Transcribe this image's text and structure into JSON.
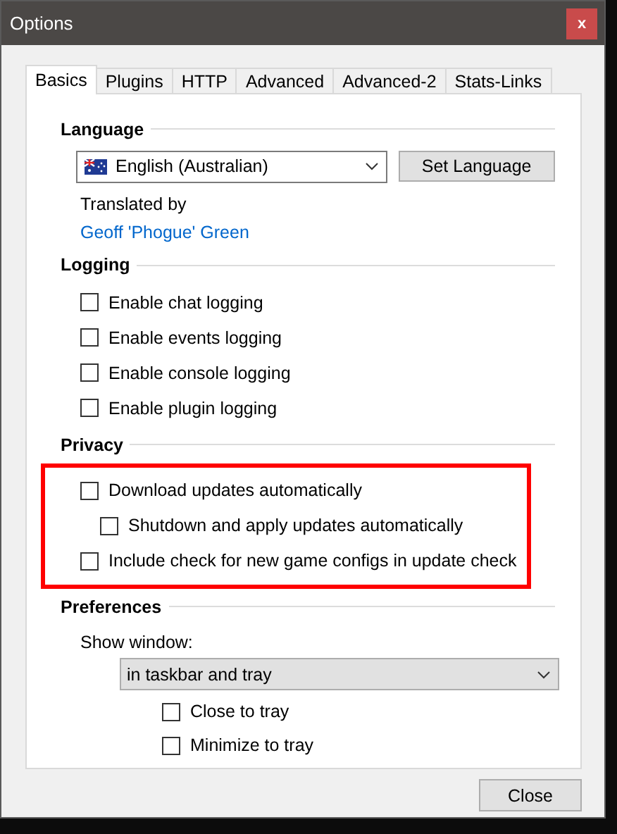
{
  "window": {
    "title": "Options",
    "close": "x"
  },
  "tabs": [
    {
      "label": "Basics",
      "selected": true
    },
    {
      "label": "Plugins",
      "selected": false
    },
    {
      "label": "HTTP",
      "selected": false
    },
    {
      "label": "Advanced",
      "selected": false
    },
    {
      "label": "Advanced-2",
      "selected": false
    },
    {
      "label": "Stats-Links",
      "selected": false
    }
  ],
  "language": {
    "heading": "Language",
    "value": "English (Australian)",
    "button": "Set Language",
    "translated_by": "Translated by",
    "translator": "Geoff 'Phogue' Green"
  },
  "logging": {
    "heading": "Logging",
    "options": [
      {
        "label": "Enable chat logging",
        "checked": false
      },
      {
        "label": "Enable events logging",
        "checked": false
      },
      {
        "label": "Enable console logging",
        "checked": false
      },
      {
        "label": "Enable plugin logging",
        "checked": false
      }
    ]
  },
  "privacy": {
    "heading": "Privacy",
    "highlighted": true,
    "options": [
      {
        "label": "Download updates automatically",
        "checked": false,
        "children": [
          {
            "label": "Shutdown and apply updates automatically",
            "checked": false
          }
        ]
      },
      {
        "label": "Include check for new game configs in update check",
        "checked": false
      }
    ]
  },
  "preferences": {
    "heading": "Preferences",
    "show_window_label": "Show window:",
    "show_window_value": "in taskbar and tray",
    "options": [
      {
        "label": "Close to tray",
        "checked": false
      },
      {
        "label": "Minimize to tray",
        "checked": false
      }
    ]
  },
  "buttons": [
    "Close"
  ]
}
